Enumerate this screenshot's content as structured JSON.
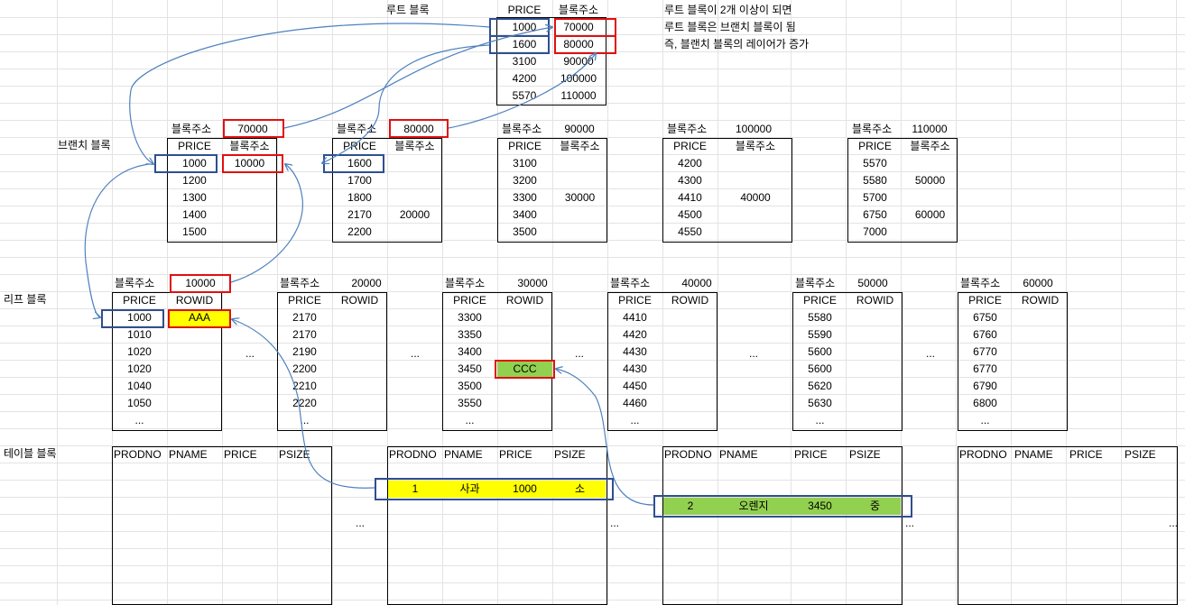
{
  "labels": {
    "root": "루트 블록",
    "branch": "브랜치 블록",
    "leaf": "리프 블록",
    "table": "테이블 블록",
    "block_addr": "블록주소",
    "price": "PRICE",
    "rowid": "ROWID",
    "ellipsis": "..."
  },
  "notes": [
    "루트 블록이 2개 이상이 되면",
    "루트 블록은 브랜치 블록이 됨",
    "즉, 블랜치 블록의 레이어가 증가"
  ],
  "root": {
    "header": [
      "PRICE",
      "블록주소"
    ],
    "rows": [
      [
        "1000",
        "70000"
      ],
      [
        "1600",
        "80000"
      ],
      [
        "3100",
        "90000"
      ],
      [
        "4200",
        "100000"
      ],
      [
        "5570",
        "110000"
      ]
    ]
  },
  "branches": [
    {
      "addr": "70000",
      "header": [
        "PRICE",
        "블록주소"
      ],
      "rows": [
        [
          "1000",
          "10000"
        ],
        [
          "1200",
          ""
        ],
        [
          "1300",
          ""
        ],
        [
          "1400",
          ""
        ],
        [
          "1500",
          ""
        ]
      ]
    },
    {
      "addr": "80000",
      "header": [
        "PRICE",
        "블록주소"
      ],
      "rows": [
        [
          "1600",
          ""
        ],
        [
          "1700",
          ""
        ],
        [
          "1800",
          ""
        ],
        [
          "2170",
          "20000"
        ],
        [
          "2200",
          ""
        ]
      ]
    },
    {
      "addr": "90000",
      "header": [
        "PRICE",
        "블록주소"
      ],
      "rows": [
        [
          "3100",
          ""
        ],
        [
          "3200",
          ""
        ],
        [
          "3300",
          "30000"
        ],
        [
          "3400",
          ""
        ],
        [
          "3500",
          ""
        ]
      ]
    },
    {
      "addr": "100000",
      "header": [
        "PRICE",
        "블록주소"
      ],
      "rows": [
        [
          "4200",
          ""
        ],
        [
          "4300",
          ""
        ],
        [
          "4410",
          "40000"
        ],
        [
          "4500",
          ""
        ],
        [
          "4550",
          ""
        ]
      ]
    },
    {
      "addr": "110000",
      "header": [
        "PRICE",
        "블록주소"
      ],
      "rows": [
        [
          "5570",
          ""
        ],
        [
          "5580",
          "50000"
        ],
        [
          "5700",
          ""
        ],
        [
          "6750",
          "60000"
        ],
        [
          "7000",
          ""
        ]
      ]
    }
  ],
  "leaves": [
    {
      "addr": "10000",
      "rows": [
        [
          "1000",
          "AAA"
        ],
        [
          "1010",
          ""
        ],
        [
          "1020",
          ""
        ],
        [
          "1020",
          ""
        ],
        [
          "1040",
          ""
        ],
        [
          "1050",
          ""
        ],
        [
          "...",
          ""
        ]
      ]
    },
    {
      "addr": "20000",
      "rows": [
        [
          "2170",
          ""
        ],
        [
          "2170",
          ""
        ],
        [
          "2190",
          ""
        ],
        [
          "2200",
          ""
        ],
        [
          "2210",
          ""
        ],
        [
          "2220",
          ""
        ],
        [
          "...",
          ""
        ]
      ]
    },
    {
      "addr": "30000",
      "rows": [
        [
          "3300",
          ""
        ],
        [
          "3350",
          ""
        ],
        [
          "3400",
          ""
        ],
        [
          "3450",
          "CCC"
        ],
        [
          "3500",
          ""
        ],
        [
          "3550",
          ""
        ],
        [
          "...",
          ""
        ]
      ]
    },
    {
      "addr": "40000",
      "rows": [
        [
          "4410",
          ""
        ],
        [
          "4420",
          ""
        ],
        [
          "4430",
          ""
        ],
        [
          "4430",
          ""
        ],
        [
          "4450",
          ""
        ],
        [
          "4460",
          ""
        ],
        [
          "...",
          ""
        ]
      ]
    },
    {
      "addr": "50000",
      "rows": [
        [
          "5580",
          ""
        ],
        [
          "5590",
          ""
        ],
        [
          "5600",
          ""
        ],
        [
          "5600",
          ""
        ],
        [
          "5620",
          ""
        ],
        [
          "5630",
          ""
        ],
        [
          "...",
          ""
        ]
      ]
    },
    {
      "addr": "60000",
      "rows": [
        [
          "6750",
          ""
        ],
        [
          "6760",
          ""
        ],
        [
          "6770",
          ""
        ],
        [
          "6770",
          ""
        ],
        [
          "6790",
          ""
        ],
        [
          "6800",
          ""
        ],
        [
          "...",
          ""
        ]
      ]
    }
  ],
  "table_header": [
    "PRODNO",
    "PNAME",
    "PRICE",
    "PSIZE"
  ],
  "table_rows": [
    {
      "prodno": "1",
      "pname": "사과",
      "price": "1000",
      "psize": "소"
    },
    {
      "prodno": "2",
      "pname": "오렌지",
      "price": "3450",
      "psize": "중"
    }
  ],
  "colors": {
    "highlight_red": "#e01010",
    "highlight_blue": "#2f4f8f",
    "fill_yellow": "#ffff00",
    "fill_green": "#92d050",
    "arrow": "#4f81bd"
  }
}
